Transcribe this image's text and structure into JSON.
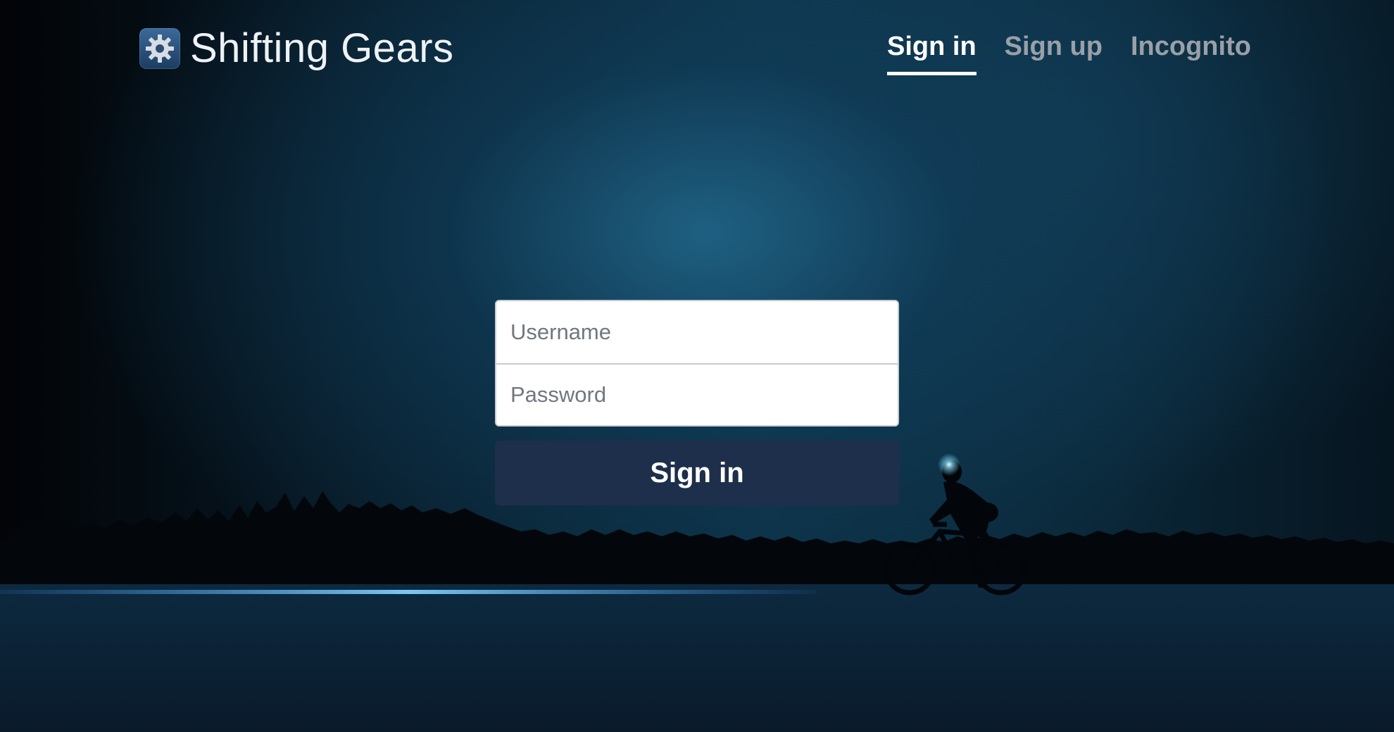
{
  "brand": {
    "name": "Shifting Gears",
    "icon": "gear-icon"
  },
  "nav": {
    "tabs": [
      {
        "label": "Sign in",
        "active": true
      },
      {
        "label": "Sign up",
        "active": false
      },
      {
        "label": "Incognito",
        "active": false
      }
    ]
  },
  "form": {
    "username": {
      "value": "",
      "placeholder": "Username"
    },
    "password": {
      "value": "",
      "placeholder": "Password"
    },
    "submit_label": "Sign in"
  },
  "colors": {
    "accent": "#1e2f4b",
    "active_tab": "#ffffff",
    "inactive_tab": "#9aa0a8"
  }
}
